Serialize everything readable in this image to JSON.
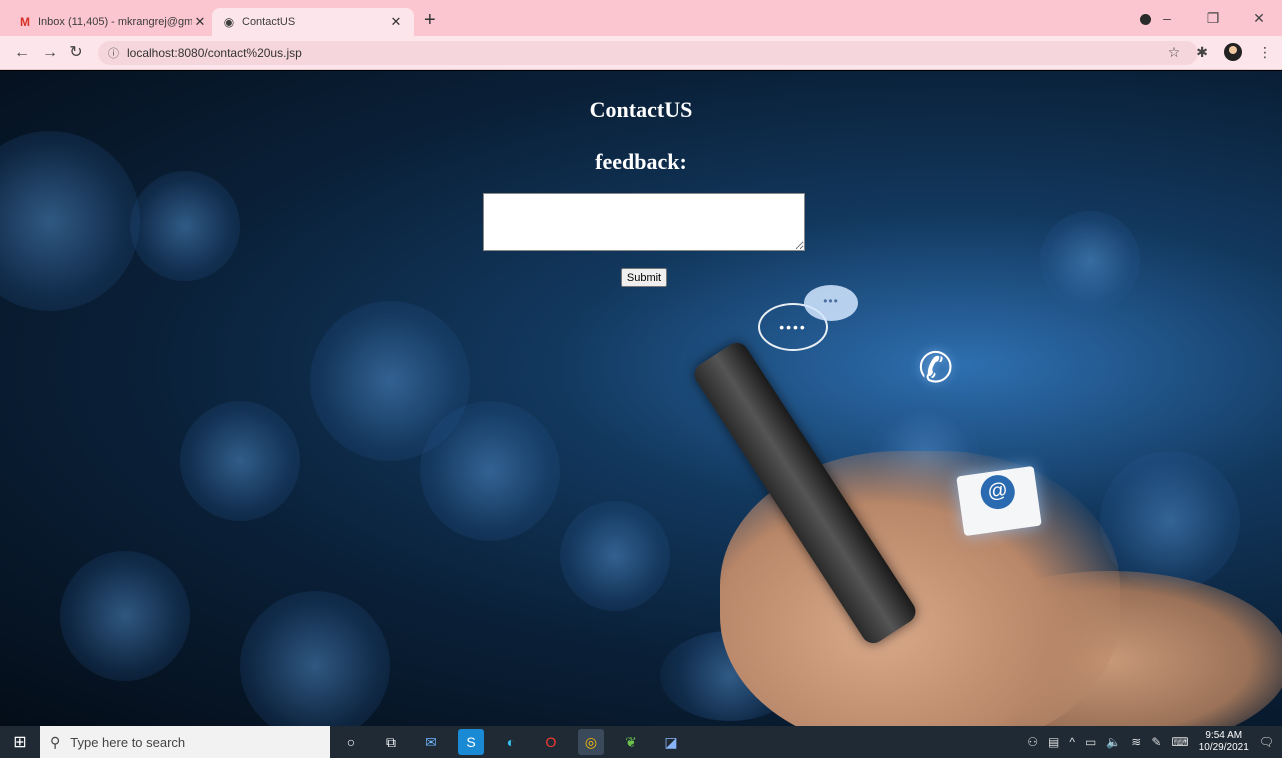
{
  "browser": {
    "tabs": [
      {
        "title": "Inbox (11,405) - mkrangrej@gm...",
        "icon": "gmail-icon",
        "active": false
      },
      {
        "title": "ContactUS",
        "icon": "globe-icon",
        "active": true
      }
    ],
    "url": "localhost:8080/contact%20us.jsp"
  },
  "page": {
    "title": "ContactUS",
    "feedback_label": "feedback:",
    "feedback_value": "",
    "submit_label": "Submit"
  },
  "illustration": {
    "chat_dots": "••••",
    "small_chat_dots": "•••",
    "at_symbol": "@"
  },
  "taskbar": {
    "search_placeholder": "Type here to search",
    "time": "9:54 AM",
    "date": "10/29/2021"
  },
  "colors": {
    "tabstrip": "#fbc6d0",
    "toolbar": "#fde6eb",
    "page_background": "#0a2038",
    "taskbar": "#1f2a35"
  }
}
